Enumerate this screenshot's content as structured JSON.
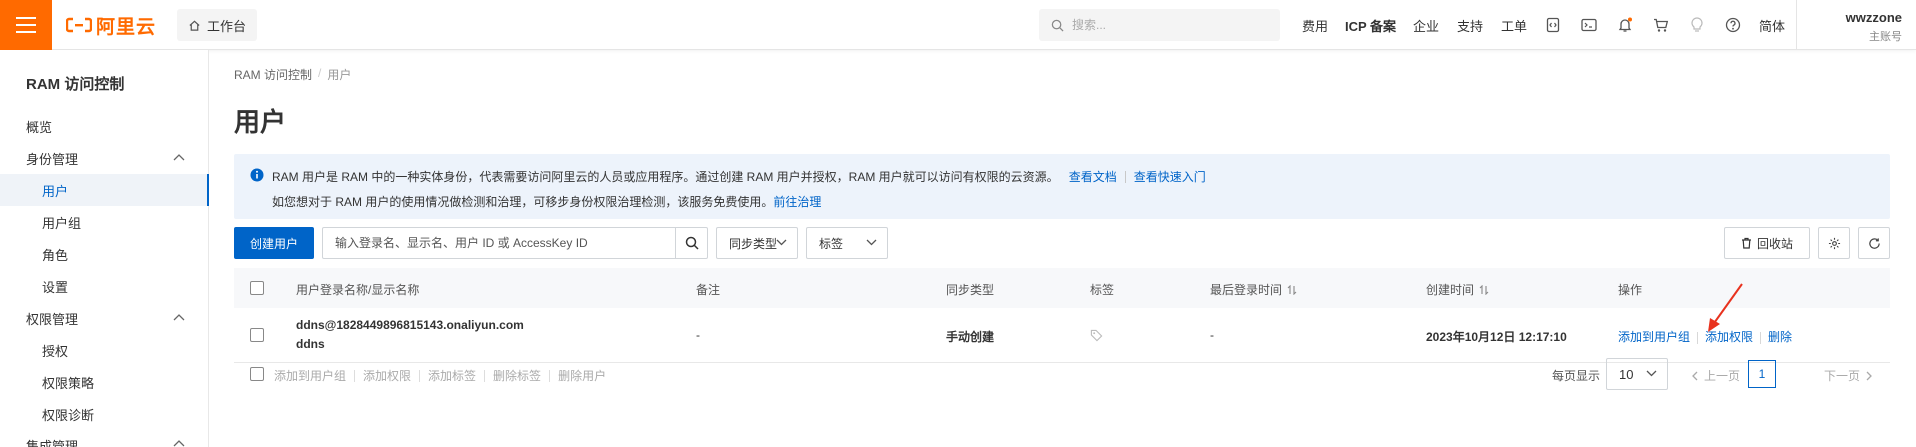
{
  "topbar": {
    "logo_text": "阿里云",
    "workbench_label": "工作台",
    "search_placeholder": "搜索...",
    "nav": [
      "费用",
      "ICP 备案",
      "企业",
      "支持",
      "工单"
    ],
    "lang_label": "简体",
    "account_name": "wwzzone",
    "account_sub": "主账号"
  },
  "sidebar": {
    "title": "RAM 访问控制",
    "items": [
      {
        "label": "概览"
      },
      {
        "label": "身份管理"
      },
      {
        "label": "用户"
      },
      {
        "label": "用户组"
      },
      {
        "label": "角色"
      },
      {
        "label": "设置"
      },
      {
        "label": "权限管理"
      },
      {
        "label": "授权"
      },
      {
        "label": "权限策略"
      },
      {
        "label": "权限诊断"
      },
      {
        "label": "集成管理"
      }
    ]
  },
  "main": {
    "breadcrumb": [
      "RAM 访问控制",
      "用户"
    ],
    "title": "用户",
    "notice": {
      "line1": "RAM 用户是 RAM 中的一种实体身份，代表需要访问阿里云的人员或应用程序。通过创建 RAM 用户并授权，RAM 用户就可以访问有权限的云资源。",
      "link1": "查看文档",
      "link2": "查看快速入门",
      "line2": "如您想对于 RAM 用户的使用情况做检测和治理，可移步身份权限治理检测，该服务免费使用。",
      "link3": "前往治理"
    },
    "toolbar": {
      "create_label": "创建用户",
      "search_placeholder": "输入登录名、显示名、用户 ID 或 AccessKey ID",
      "sync_type_label": "同步类型",
      "tag_label": "标签",
      "recycle_label": "回收站"
    },
    "table": {
      "headers": [
        "用户登录名称/显示名称",
        "备注",
        "同步类型",
        "标签",
        "最后登录时间",
        "创建时间",
        "操作"
      ],
      "rows": [
        {
          "login_name": "ddns@1828449896815143.onaliyun.com",
          "display_name": "ddns",
          "remark": "-",
          "sync_type": "手动创建",
          "last_login": "-",
          "created": "2023年10月12日 12:17:10",
          "actions": [
            "添加到用户组",
            "添加权限",
            "删除"
          ]
        }
      ]
    },
    "footer": {
      "bulk_actions": [
        "添加到用户组",
        "添加权限",
        "添加标签",
        "删除标签",
        "删除用户"
      ],
      "page_size_label": "每页显示",
      "page_size": "10",
      "prev_label": "上一页",
      "current_page": "1",
      "next_label": "下一页"
    }
  },
  "colors": {
    "brand": "#ff6a00",
    "primary": "#0064c8",
    "annotation_arrow": "#e8321e"
  }
}
